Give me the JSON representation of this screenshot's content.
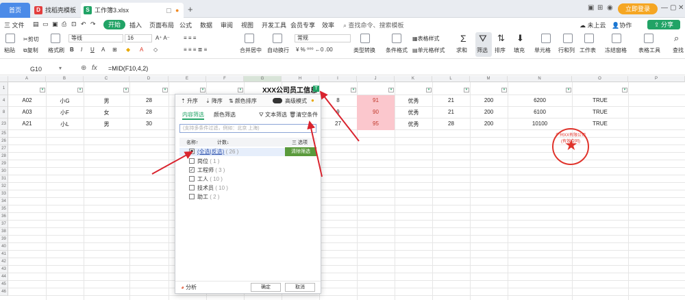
{
  "titlebar": {
    "home": "首页",
    "tabs": [
      {
        "label": "找稻壳模板",
        "icon": "D"
      },
      {
        "label": "工作簿3.xlsx",
        "icon": "S"
      }
    ],
    "login": "立即登录"
  },
  "menubar": {
    "file": "三 文件",
    "start": "开始",
    "items": [
      "插入",
      "页面布局",
      "公式",
      "数据",
      "审阅",
      "视图",
      "开发工具",
      "会员专享",
      "效率"
    ],
    "search": "查找命令、搜索模板",
    "cloud": "未上云",
    "collab": "协作",
    "share": "分享"
  },
  "ribbon": {
    "paste": "粘贴",
    "cut": "剪切",
    "copy": "复制",
    "format_painter": "格式刷",
    "font": "等线",
    "font_size": "16",
    "merge": "合并居中",
    "wrap": "自动换行",
    "number_format": "常规",
    "type_convert": "类型转换",
    "cond_format": "条件格式",
    "table_style": "表格样式",
    "cell_style": "单元格样式",
    "sum": "求和",
    "filter": "筛选",
    "sort": "排序",
    "fill": "填充",
    "cell": "单元格",
    "rowcol": "行和列",
    "worksheet": "工作表",
    "freeze": "冻结窗格",
    "table_tools": "表格工具",
    "find": "查找"
  },
  "formula_bar": {
    "name_box": "G10",
    "fx": "fx",
    "formula": "=MID(F10,4,2)"
  },
  "sheet": {
    "columns": [
      "A",
      "B",
      "C",
      "D",
      "E",
      "F",
      "G",
      "H",
      "I",
      "J",
      "K",
      "L",
      "M",
      "N",
      "O",
      "P"
    ],
    "row_numbers": [
      "1",
      "4",
      "8",
      "23",
      "25",
      "26",
      "27",
      "28",
      "29",
      "30",
      "31",
      "32",
      "33",
      "34",
      "35",
      "36",
      "37",
      "38",
      "39",
      "40",
      "41",
      "42",
      "43",
      "44",
      "45",
      "46",
      "47",
      "48"
    ],
    "title": "XXX公司员工信息",
    "rows": [
      [
        "A02",
        "小G",
        "男",
        "28",
        "8",
        "91",
        "优秀",
        "21",
        "200",
        "6200",
        "TRUE"
      ],
      [
        "A03",
        "小F",
        "女",
        "28",
        "9",
        "90",
        "优秀",
        "21",
        "200",
        "6100",
        "TRUE"
      ],
      [
        "A21",
        "小L",
        "男",
        "30",
        "27",
        "95",
        "优秀",
        "28",
        "200",
        "10100",
        "TRUE"
      ]
    ],
    "seal_text": "广州XX有限公司(有效合同)"
  },
  "filter_popup": {
    "sort_asc": "升序",
    "sort_desc": "降序",
    "color_sort": "颜色排序",
    "advanced": "高级模式",
    "tab_content": "内容筛选",
    "tab_color": "颜色筛选",
    "text_filter": "文本筛选",
    "clear_condition": "清空条件",
    "search_placeholder": "(支持多条件过滤，例如：北京 上海)",
    "col_name": "名称↑",
    "col_count": "计数↓",
    "options": "三 选项",
    "clear_filter": "清除筛选",
    "items": [
      {
        "label": "(全选|反选)",
        "count": "( 26 )",
        "checked": "■"
      },
      {
        "label": "岗位",
        "count": "( 1 )",
        "checked": ""
      },
      {
        "label": "工程师",
        "count": "( 3 )",
        "checked": "✓"
      },
      {
        "label": "工人",
        "count": "( 10 )",
        "checked": ""
      },
      {
        "label": "技术员",
        "count": "( 10 )",
        "checked": ""
      },
      {
        "label": "助工",
        "count": "( 2 )",
        "checked": ""
      }
    ],
    "analysis": "分析",
    "ok": "确定",
    "cancel": "取消"
  }
}
